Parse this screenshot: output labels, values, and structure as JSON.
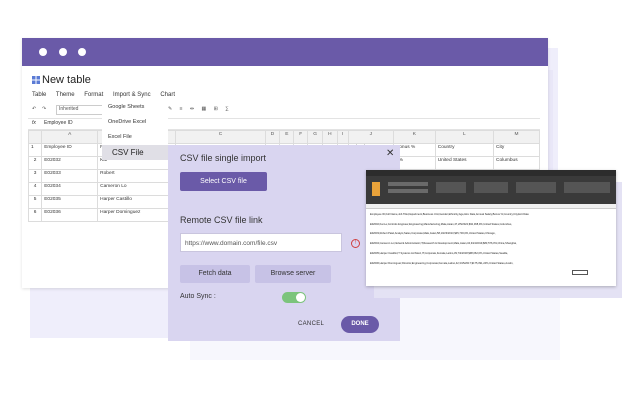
{
  "window": {
    "doc_title": "New table"
  },
  "menubar": [
    "Table",
    "Theme",
    "Format",
    "Import & Sync",
    "Chart"
  ],
  "toolbar": {
    "font": "Inherited"
  },
  "formula": {
    "fx": "fx",
    "value": "Employee ID"
  },
  "sheet": {
    "columns": [
      "",
      "A",
      "B",
      "C",
      "D",
      "E",
      "F",
      "G",
      "H",
      "I",
      "J",
      "K",
      "L",
      "M"
    ],
    "row1": [
      "1",
      "Employee ID",
      "Full N",
      "",
      "",
      "",
      "",
      "",
      "",
      "",
      "ual Salary",
      "Bonus %",
      "Country",
      "City"
    ],
    "rows": [
      [
        "2",
        "E02032",
        "Kai",
        "",
        "",
        "",
        "",
        "",
        "",
        "",
        ",555",
        "0%",
        "United States",
        "Columbus"
      ],
      [
        "3",
        "E02033",
        "Robert",
        "Analyst",
        "",
        "",
        "",
        "",
        "",
        "",
        "",
        "0%",
        "",
        "Chicago"
      ],
      [
        "4",
        "E02034",
        "Cameron Lo",
        "Network Administrator",
        "",
        "",
        "",
        "",
        "",
        "",
        "",
        "",
        "",
        ""
      ],
      [
        "5",
        "E02035",
        "Harper Castillo",
        "IT Systems Architect",
        "",
        "",
        "",
        "",
        "",
        "",
        "",
        "",
        "",
        ""
      ],
      [
        "6",
        "E02036",
        "Harper Dominguez",
        "Director",
        "",
        "",
        "",
        "",
        "",
        "",
        "",
        "",
        "",
        ""
      ]
    ]
  },
  "import_menu": [
    "Google Sheets",
    "OneDrive Excel",
    "Excel File",
    "CSV File"
  ],
  "dialog": {
    "title": "CSV file single import",
    "close": "✕",
    "select_button": "Select CSV file",
    "remote_label": "Remote CSV file link",
    "url_value": "https://www.domain.com/file.csv",
    "error_icon": "!",
    "fetch_button": "Fetch data",
    "browse_button": "Browse server",
    "autosync_label": "Auto Sync :",
    "autosync_on": true,
    "cancel_button": "CANCEL",
    "done_button": "DONE"
  },
  "excel_preview": {
    "rows": [
      "Employee ID,Full Name,Job Title,Department,Business Unit,Gender,Ethnicity,Age,Hire Date,Annual Salary,Bonus %,Country,City,Exit Date",
      "E02002,Kai Le,Controls Engineer,Engineering,Manufacturing,Male,Asian,47,2/5/2022,$92,368,0%,United States,Columbus,",
      "E02003,Robert Patel,Analyst,Sales,Corporate,Male,Asian,58,10/23/2013,$45,703,0%,United States,Chicago,",
      "E02004,Cameron Lo,Network Administrator,IT,Research & Development,Male,Asian,34,3/24/2019,$83,576,0%,China,Shanghai,",
      "E02005,Harper Castillo,IT Systems Architect,IT,Corporate,Female,Latino,39,7/2/2018,$98,062,0%,United States,Seattle,",
      "E02006,Harper Dominguez,Director,Engineering,Corporate,Female,Latino,42,3/15/2017,$175,391,24%,United States,Austin,"
    ]
  }
}
